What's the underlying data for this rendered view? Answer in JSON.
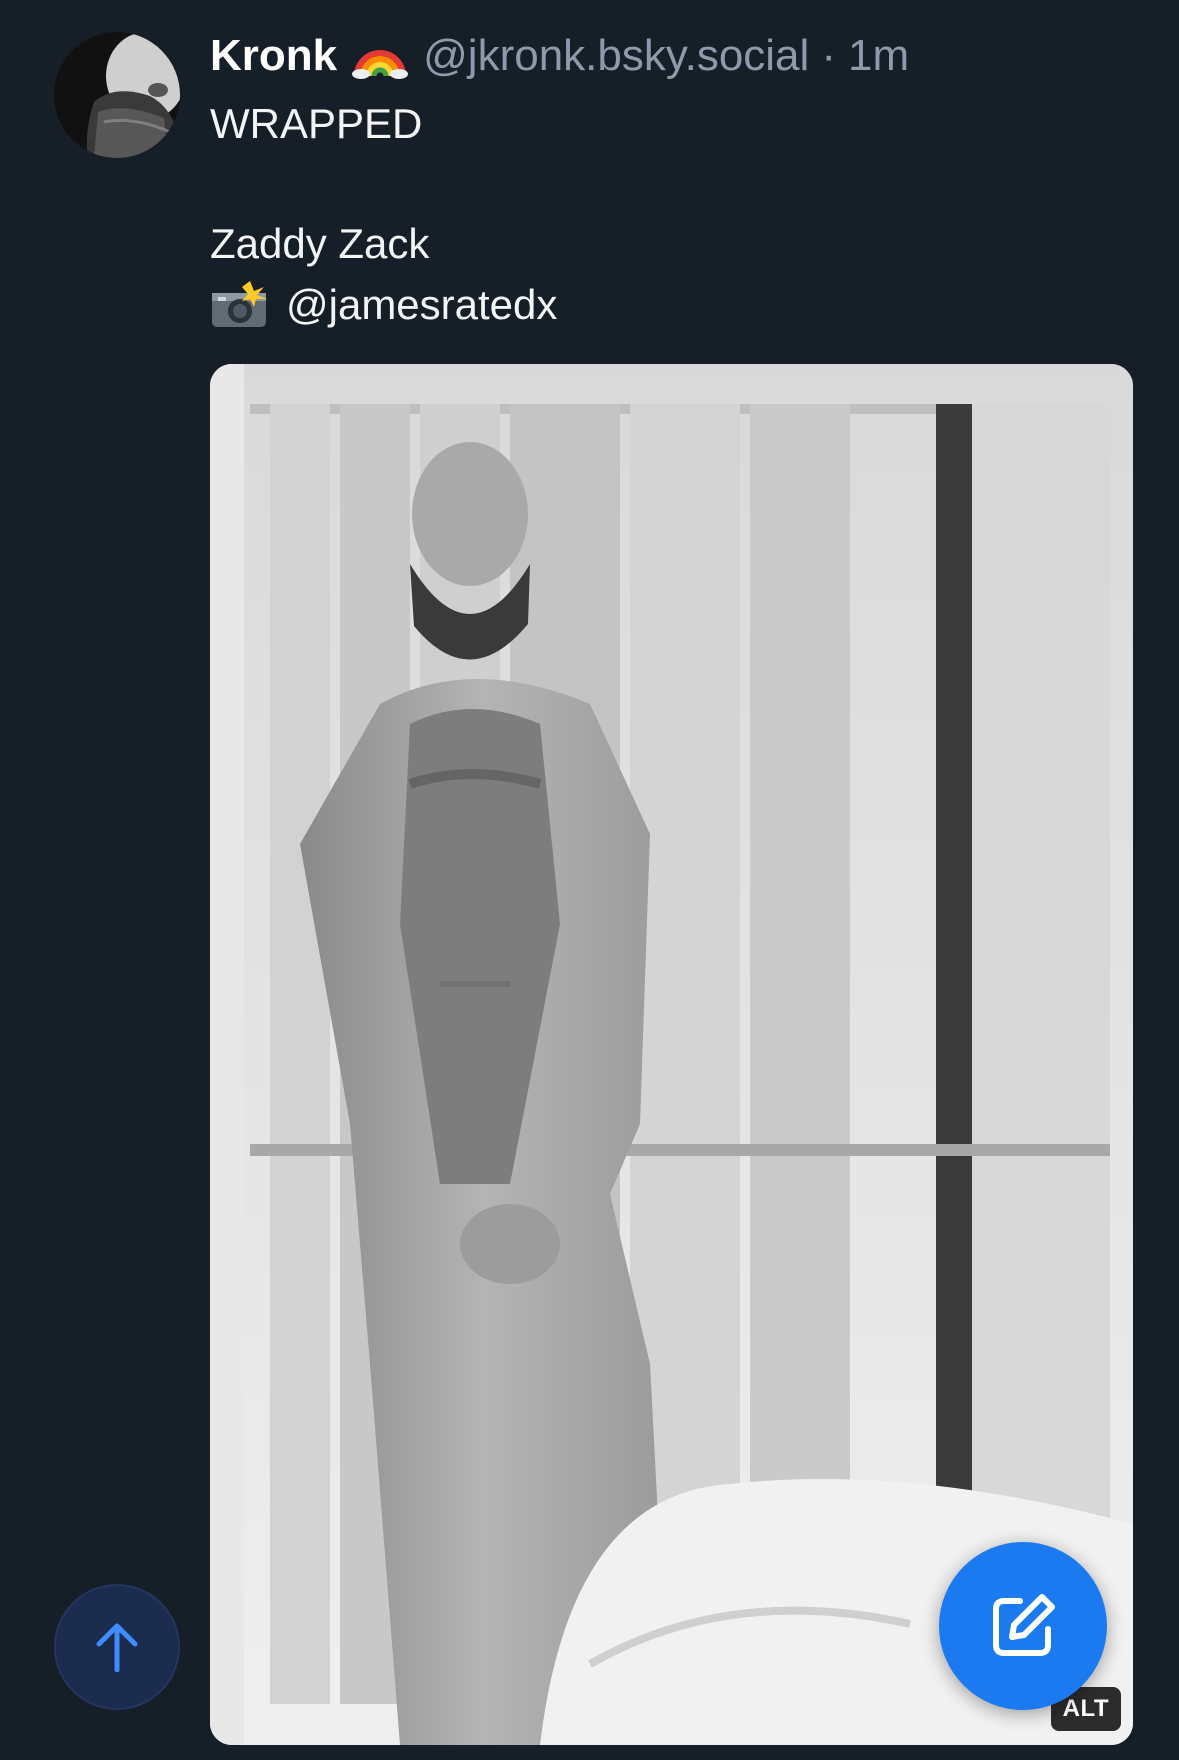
{
  "post": {
    "display_name": "Kronk",
    "handle": "@jkronk.bsky.social",
    "separator": "·",
    "timestamp": "1m",
    "lines": [
      "WRAPPED",
      "Zaddy Zack"
    ],
    "mention": "@jamesratedx",
    "name_emoji": "rainbow-emoji",
    "mention_emoji": "camera-flash-emoji"
  },
  "media": {
    "alt_badge": "ALT"
  },
  "fab": {
    "scroll_top_icon": "arrow-up-icon",
    "compose_icon": "compose-icon",
    "scroll_top_color": "#1b2b4e",
    "compose_color": "#1c7af0"
  },
  "colors": {
    "background": "#161e27",
    "secondary_text": "#8d9aab",
    "accent": "#1c7af0"
  }
}
